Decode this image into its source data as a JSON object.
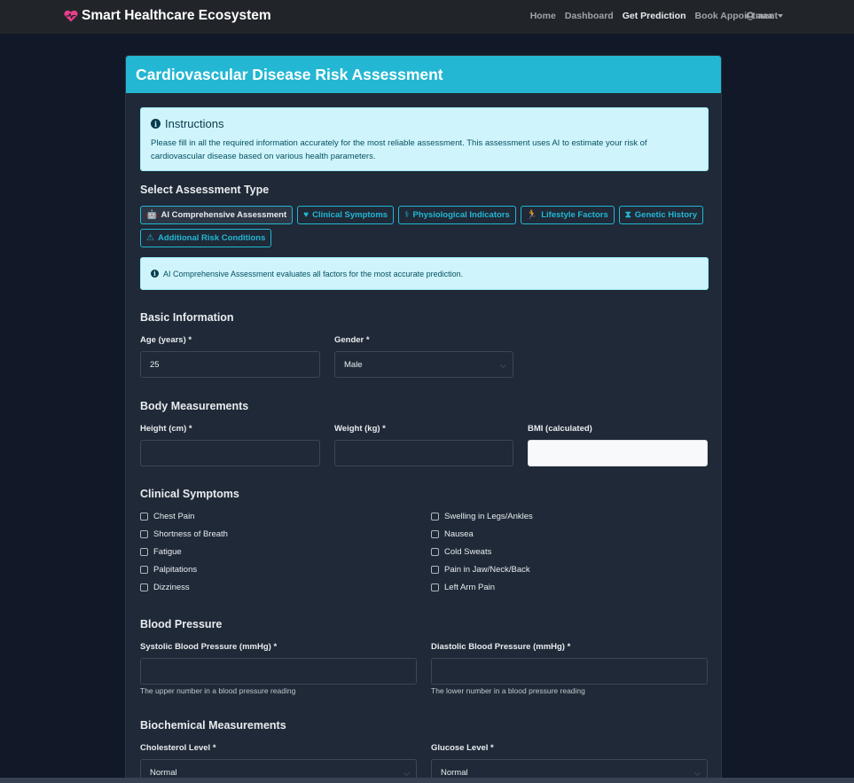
{
  "navbar": {
    "brand": "Smart Healthcare Ecosystem",
    "brand_icon": "heart-pulse-icon",
    "links": [
      "Home",
      "Dashboard",
      "Get Prediction",
      "Book Appointment"
    ],
    "user": "aaa"
  },
  "card": {
    "title": "Cardiovascular Disease Risk Assessment",
    "instructions": {
      "heading": "Instructions",
      "body": "Please fill in all the required information accurately for the most reliable assessment. This assessment uses AI to estimate your risk of cardiovascular disease based on various health parameters."
    },
    "assessment_type": {
      "title": "Select Assessment Type",
      "options": [
        {
          "label": "AI Comprehensive Assessment",
          "icon": "robot-icon",
          "glyph": "🤖"
        },
        {
          "label": "Clinical Symptoms",
          "icon": "heart-pulse-icon",
          "glyph": "♥"
        },
        {
          "label": "Physiological Indicators",
          "icon": "stethoscope-icon",
          "glyph": "⚕"
        },
        {
          "label": "Lifestyle Factors",
          "icon": "running-icon",
          "glyph": "🏃"
        },
        {
          "label": "Genetic History",
          "icon": "dna-icon",
          "glyph": "⧗"
        },
        {
          "label": "Additional Risk Conditions",
          "icon": "warning-icon",
          "glyph": "⚠"
        }
      ],
      "note": "AI Comprehensive Assessment evaluates all factors for the most accurate prediction."
    },
    "basic_info": {
      "title": "Basic Information",
      "age_label": "Age (years) *",
      "age_value": "25",
      "gender_label": "Gender *",
      "gender_value": "Male"
    },
    "body": {
      "title": "Body Measurements",
      "height_label": "Height (cm) *",
      "weight_label": "Weight (kg) *",
      "bmi_label": "BMI (calculated)"
    },
    "symptoms": {
      "title": "Clinical Symptoms",
      "left": [
        "Chest Pain",
        "Shortness of Breath",
        "Fatigue",
        "Palpitations",
        "Dizziness"
      ],
      "right": [
        "Swelling in Legs/Ankles",
        "Nausea",
        "Cold Sweats",
        "Pain in Jaw/Neck/Back",
        "Left Arm Pain"
      ]
    },
    "bp": {
      "title": "Blood Pressure",
      "systolic_label": "Systolic Blood Pressure (mmHg) *",
      "diastolic_label": "Diastolic Blood Pressure (mmHg) *",
      "systolic_help": "The upper number in a blood pressure reading",
      "diastolic_help": "The lower number in a blood pressure reading"
    },
    "biochem": {
      "title": "Biochemical Measurements",
      "cholesterol_label": "Cholesterol Level *",
      "cholesterol_value": "Normal",
      "glucose_label": "Glucose Level *",
      "glucose_value": "Normal"
    }
  },
  "colors": {
    "accent": "#23b7d3",
    "brand_heart": "#e83e8c",
    "background": "#111827",
    "card": "#1f2937",
    "alert": "#cff4fc"
  }
}
